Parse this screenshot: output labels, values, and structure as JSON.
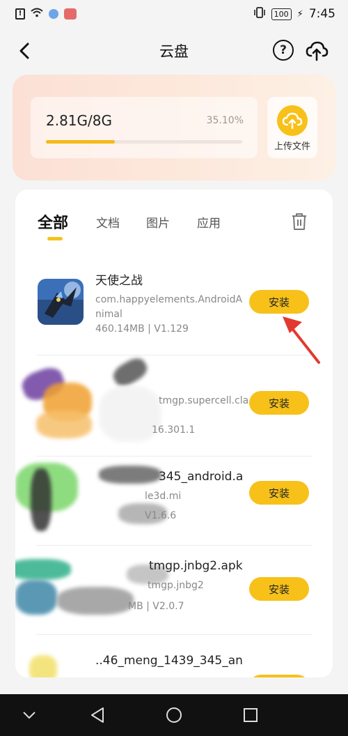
{
  "status_bar": {
    "time": "7:45",
    "battery": "100"
  },
  "header": {
    "title": "云盘"
  },
  "storage": {
    "used_text": "2.81G/8G",
    "percent_text": "35.10%",
    "percent_value": 35.1,
    "upload_label": "上传文件"
  },
  "tabs": [
    {
      "label": "全部",
      "active": true
    },
    {
      "label": "文档",
      "active": false
    },
    {
      "label": "图片",
      "active": false
    },
    {
      "label": "应用",
      "active": false
    }
  ],
  "apps": [
    {
      "name": "天使之战",
      "package": "com.happyelements.AndroidAnimal",
      "meta": "460.14MB | V1.129",
      "install_label": "安装"
    },
    {
      "name": "",
      "package": "tmgp.supercell.cla",
      "meta": "16.301.1",
      "install_label": "安装"
    },
    {
      "name": "345_android.a",
      "package": "le3d.mi",
      "meta": "V1.6.6",
      "install_label": "安装"
    },
    {
      "name": "tmgp.jnbg2.apk",
      "package": "tmgp.jnbg2",
      "meta": "MB | V2.0.7",
      "install_label": "安装"
    },
    {
      "name": "..46_meng_1439_345_an",
      "package": "",
      "meta": "",
      "install_label": "安装"
    }
  ],
  "colors": {
    "accent": "#f7c11a",
    "arrow": "#e23a2f"
  },
  "icons": [
    "back-icon",
    "help-icon",
    "cloud-upload-icon",
    "trash-icon",
    "nav-back-icon",
    "nav-home-icon",
    "nav-recents-icon",
    "nav-down-icon"
  ]
}
